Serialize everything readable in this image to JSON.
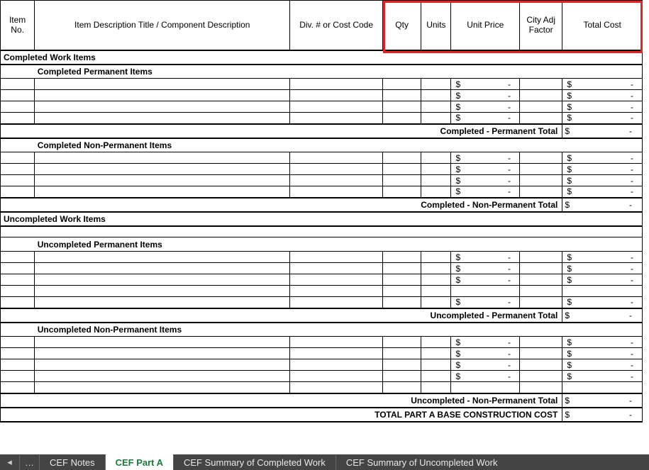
{
  "headers": {
    "item_no": "Item No.",
    "description": "Item Description Title / Component Description",
    "div": "Div. # or Cost Code",
    "qty": "Qty",
    "units": "Units",
    "unit_price": "Unit Price",
    "city_adj": "City Adj Factor",
    "total_cost": "Total Cost"
  },
  "sections": {
    "completed": {
      "title": "Completed Work Items",
      "permanent": {
        "title": "Completed Permanent Items",
        "rows": [
          {
            "unit_price_sym": "$",
            "unit_price_val": "-",
            "total_sym": "$",
            "total_val": "-"
          },
          {
            "unit_price_sym": "$",
            "unit_price_val": "-",
            "total_sym": "$",
            "total_val": "-"
          },
          {
            "unit_price_sym": "$",
            "unit_price_val": "-",
            "total_sym": "$",
            "total_val": "-"
          },
          {
            "unit_price_sym": "$",
            "unit_price_val": "-",
            "total_sym": "$",
            "total_val": "-"
          }
        ],
        "subtotal_label": "Completed - Permanent Total",
        "subtotal_sym": "$",
        "subtotal_val": "-"
      },
      "nonpermanent": {
        "title": "Completed Non-Permanent Items",
        "rows": [
          {
            "unit_price_sym": "$",
            "unit_price_val": "-",
            "total_sym": "$",
            "total_val": "-"
          },
          {
            "unit_price_sym": "$",
            "unit_price_val": "-",
            "total_sym": "$",
            "total_val": "-"
          },
          {
            "unit_price_sym": "$",
            "unit_price_val": "-",
            "total_sym": "$",
            "total_val": "-"
          },
          {
            "unit_price_sym": "$",
            "unit_price_val": "-",
            "total_sym": "$",
            "total_val": "-"
          }
        ],
        "subtotal_label": "Completed - Non-Permanent Total",
        "subtotal_sym": "$",
        "subtotal_val": "-"
      }
    },
    "uncompleted": {
      "title": "Uncompleted Work Items",
      "permanent": {
        "title": "Uncompleted Permanent Items",
        "rows": [
          {
            "unit_price_sym": "$",
            "unit_price_val": "-",
            "total_sym": "$",
            "total_val": "-"
          },
          {
            "unit_price_sym": "$",
            "unit_price_val": "-",
            "total_sym": "$",
            "total_val": "-"
          },
          {
            "unit_price_sym": "$",
            "unit_price_val": "-",
            "total_sym": "$",
            "total_val": "-"
          },
          {
            "unit_price_sym": "",
            "unit_price_val": "",
            "total_sym": "",
            "total_val": ""
          },
          {
            "unit_price_sym": "$",
            "unit_price_val": "-",
            "total_sym": "$",
            "total_val": "-"
          }
        ],
        "subtotal_label": "Uncompleted - Permanent Total",
        "subtotal_sym": "$",
        "subtotal_val": "-"
      },
      "nonpermanent": {
        "title": "Uncompleted Non-Permanent Items",
        "rows": [
          {
            "unit_price_sym": "$",
            "unit_price_val": "-",
            "total_sym": "$",
            "total_val": "-"
          },
          {
            "unit_price_sym": "$",
            "unit_price_val": "-",
            "total_sym": "$",
            "total_val": "-"
          },
          {
            "unit_price_sym": "$",
            "unit_price_val": "-",
            "total_sym": "$",
            "total_val": "-"
          },
          {
            "unit_price_sym": "$",
            "unit_price_val": "-",
            "total_sym": "$",
            "total_val": "-"
          },
          {
            "unit_price_sym": "",
            "unit_price_val": "",
            "total_sym": "",
            "total_val": ""
          }
        ],
        "subtotal_label": "Uncompleted - Non-Permanent Total",
        "subtotal_sym": "$",
        "subtotal_val": "-"
      }
    }
  },
  "grand_total": {
    "label": "TOTAL PART A BASE CONSTRUCTION COST",
    "sym": "$",
    "val": "-"
  },
  "tabs": {
    "nav_prev": "◂",
    "ellipsis": "…",
    "items": [
      {
        "label": "CEF Notes",
        "active": false
      },
      {
        "label": "CEF Part A",
        "active": true
      },
      {
        "label": "CEF Summary of Completed Work",
        "active": false
      },
      {
        "label": "CEF Summary of Uncompleted Work",
        "active": false
      }
    ]
  }
}
